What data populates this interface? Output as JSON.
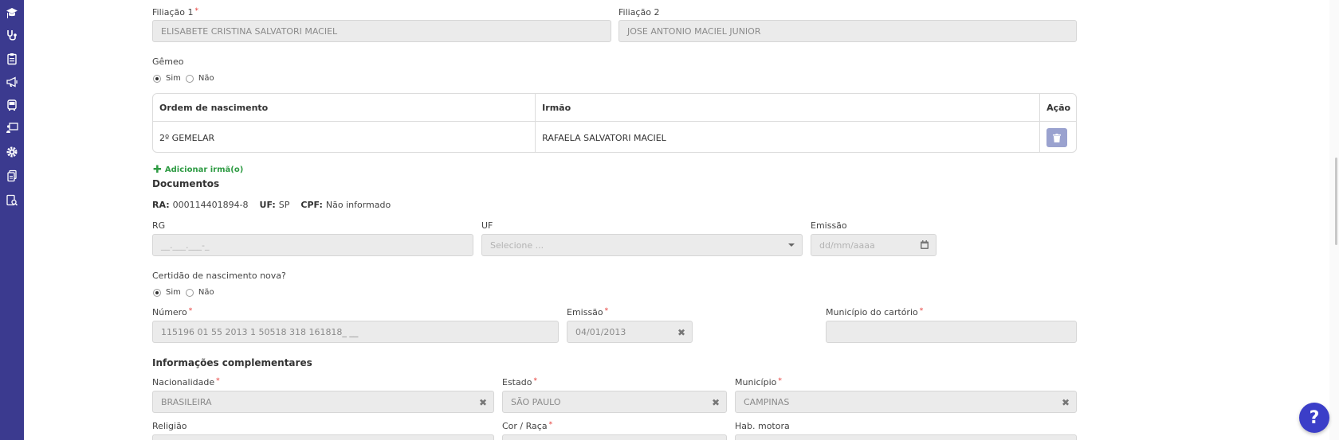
{
  "sidebar": {
    "items": [
      {
        "icon": "graduation-cap-icon"
      },
      {
        "icon": "stethoscope-icon"
      },
      {
        "icon": "clipboard-icon"
      },
      {
        "icon": "megaphone-icon"
      },
      {
        "icon": "bus-icon"
      },
      {
        "icon": "presentation-icon"
      },
      {
        "icon": "gear-icon"
      },
      {
        "icon": "documents-icon"
      },
      {
        "icon": "search-document-icon"
      }
    ]
  },
  "filiacao": {
    "f1_label": "Filiação 1",
    "f1_value": "ELISABETE CRISTINA SALVATORI MACIEL",
    "f2_label": "Filiação 2",
    "f2_value": "JOSE ANTONIO MACIEL JUNIOR"
  },
  "gemeo": {
    "label": "Gêmeo",
    "yes": "Sim",
    "no": "Não",
    "selected": "Sim"
  },
  "twins_table": {
    "headers": [
      "Ordem de nascimento",
      "Irmão",
      "Ação"
    ],
    "rows": [
      {
        "ordem": "2º GEMELAR",
        "irmao": "RAFAELA SALVATORI MACIEL"
      }
    ]
  },
  "add_sibling": "Adicionar irmã(o)",
  "documentos": {
    "title": "Documentos",
    "ra_label": "RA:",
    "ra_value": "000114401894-8",
    "uf_label": "UF:",
    "uf_value": "SP",
    "cpf_label": "CPF:",
    "cpf_value": "Não informado",
    "rg_label": "RG",
    "rg_placeholder": "__.___.___-_",
    "uf_field_label": "UF",
    "uf_placeholder": "Selecione ...",
    "emissao_label": "Emissão",
    "emissao_placeholder": "dd/mm/aaaa"
  },
  "certidao": {
    "label": "Certidão de nascimento nova?",
    "yes": "Sim",
    "no": "Não",
    "numero_label": "Número",
    "numero_value": "115196 01 55 2013 1 50518 318 161818_ __",
    "emissao_label": "Emissão",
    "emissao_value": "04/01/2013",
    "municipio_label": "Município do cartório",
    "municipio_value": ""
  },
  "info_comp": {
    "title": "Informações complementares",
    "nacionalidade_label": "Nacionalidade",
    "nacionalidade_value": "BRASILEIRA",
    "estado_label": "Estado",
    "estado_value": "SÃO PAULO",
    "municipio_label": "Município",
    "municipio_value": "CAMPINAS",
    "religiao_label": "Religião",
    "cor_label": "Cor / Raça",
    "hab_label": "Hab. motora"
  },
  "help": "?",
  "required_mark": "*",
  "clear_mark": "✖"
}
